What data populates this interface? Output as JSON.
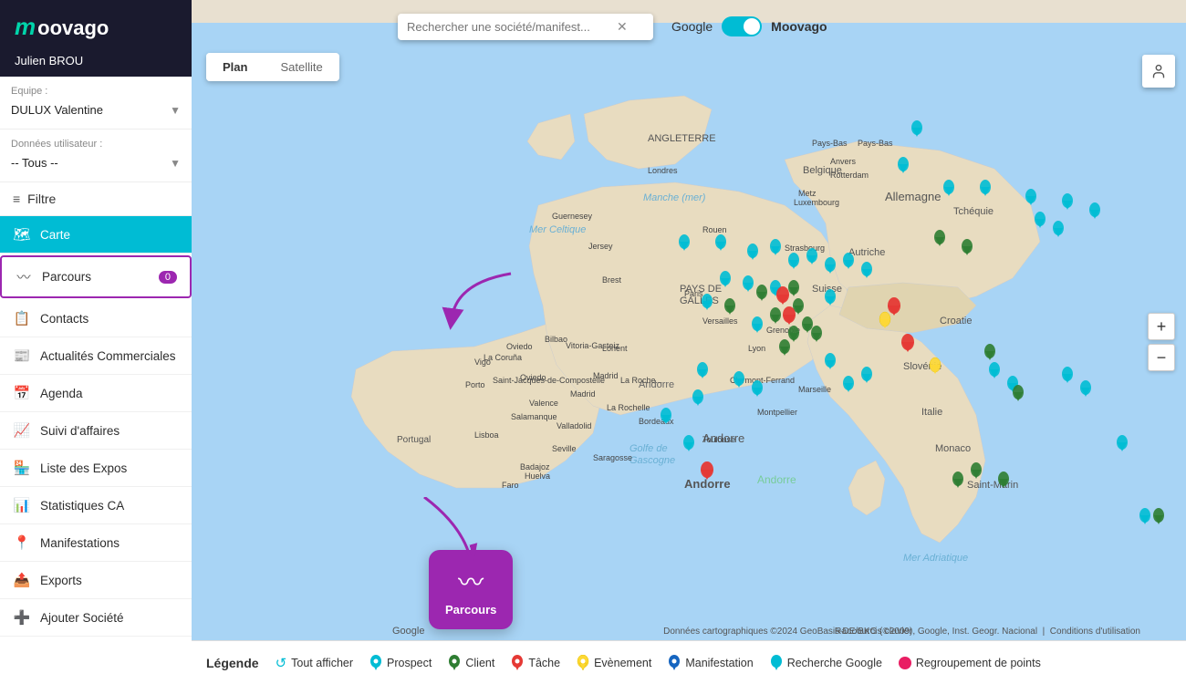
{
  "app": {
    "name": "moovago",
    "logo_m": "m",
    "logo_rest": "oovago"
  },
  "user": {
    "name": "Julien BROU"
  },
  "team": {
    "label": "Equipe :",
    "value": "DULUX Valentine"
  },
  "user_data": {
    "label": "Données utilisateur :",
    "value": "-- Tous --"
  },
  "filter": {
    "label": "Filtre"
  },
  "nav": {
    "items": [
      {
        "id": "carte",
        "label": "Carte",
        "icon": "🗺",
        "active": true
      },
      {
        "id": "parcours",
        "label": "Parcours",
        "icon": "〰",
        "active": false,
        "badge": "0"
      },
      {
        "id": "contacts",
        "label": "Contacts",
        "icon": "📋",
        "active": false
      },
      {
        "id": "actualites",
        "label": "Actualités Commerciales",
        "icon": "📰",
        "active": false
      },
      {
        "id": "agenda",
        "label": "Agenda",
        "icon": "📅",
        "active": false
      },
      {
        "id": "suivi",
        "label": "Suivi d'affaires",
        "icon": "📈",
        "active": false
      },
      {
        "id": "expos",
        "label": "Liste des Expos",
        "icon": "🏪",
        "active": false
      },
      {
        "id": "stats",
        "label": "Statistiques CA",
        "icon": "📊",
        "active": false
      },
      {
        "id": "manifestations",
        "label": "Manifestations",
        "icon": "📍",
        "active": false
      },
      {
        "id": "exports",
        "label": "Exports",
        "icon": "📤",
        "active": false
      },
      {
        "id": "ajouter",
        "label": "Ajouter Société",
        "icon": "➕",
        "active": false
      }
    ]
  },
  "map": {
    "tab_plan": "Plan",
    "tab_satellite": "Satellite",
    "active_tab": "Plan",
    "search_placeholder": "Rechercher une société/manifest..."
  },
  "toggle": {
    "left_label": "Google",
    "right_label": "Moovago"
  },
  "legend": {
    "title": "Légende",
    "items": [
      {
        "id": "all",
        "label": "Tout afficher",
        "color": "#00bcd4",
        "icon": "↺"
      },
      {
        "id": "prospect",
        "label": "Prospect",
        "color": "#00bcd4"
      },
      {
        "id": "client",
        "label": "Client",
        "color": "#2e7d32"
      },
      {
        "id": "tache",
        "label": "Tâche",
        "color": "#e53935"
      },
      {
        "id": "evenement",
        "label": "Evènement",
        "color": "#fdd835"
      },
      {
        "id": "manifestation",
        "label": "Manifestation",
        "color": "#1565c0"
      },
      {
        "id": "recherche",
        "label": "Recherche Google",
        "color": "#00bcd4"
      },
      {
        "id": "regroupement",
        "label": "Regroupement de points",
        "color": "#e91e63"
      }
    ]
  },
  "parcours_card": {
    "label": "Parcours"
  },
  "controls": {
    "zoom_in": "+",
    "zoom_out": "−"
  },
  "footer": {
    "google_wm": "Google",
    "shortcuts": "Raccourcis clavier",
    "attribution": "Données cartographiques ©2024 GeoBasis-DE/BKG (©2009), Google, Inst. Geogr. Nacional",
    "conditions": "Conditions d'utilisation"
  }
}
